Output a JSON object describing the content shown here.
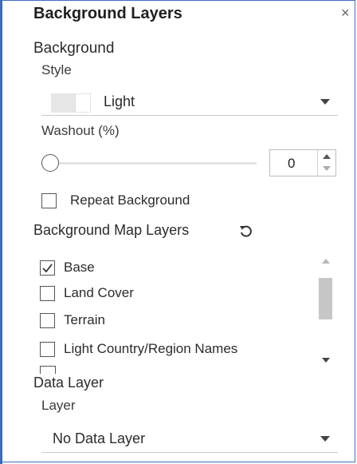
{
  "panel": {
    "title": "Background Layers",
    "close_glyph": "×"
  },
  "background": {
    "section_label": "Background",
    "style_label": "Style",
    "style_value": "Light",
    "washout_label": "Washout (%)",
    "washout_value": "0",
    "repeat_label": "Repeat Background",
    "repeat_checked": false
  },
  "map_layers": {
    "section_label": "Background Map Layers",
    "reset_icon": "reset-icon",
    "items": [
      {
        "label": "Base",
        "checked": true
      },
      {
        "label": "Land Cover",
        "checked": false
      },
      {
        "label": "Terrain",
        "checked": false
      },
      {
        "label": "Light Country/Region Names",
        "checked": false
      }
    ]
  },
  "data_layer": {
    "section_label": "Data Layer",
    "layer_label": "Layer",
    "layer_value": "No Data Layer"
  },
  "colors": {
    "frame_accent": "#2f6bc4"
  }
}
